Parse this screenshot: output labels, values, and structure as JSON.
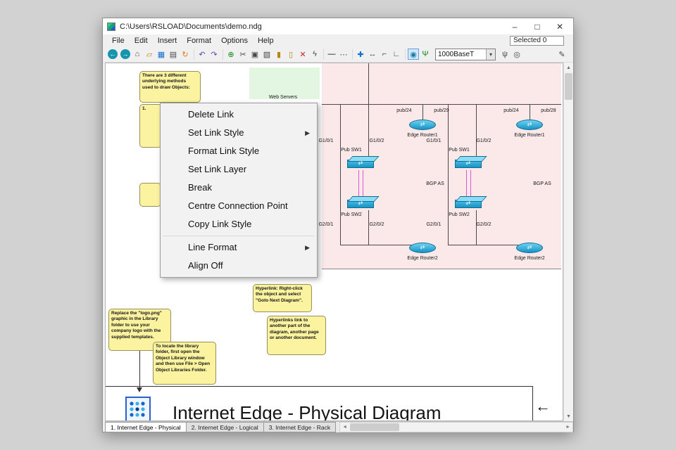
{
  "window": {
    "title": "C:\\Users\\RSLOAD\\Documents\\demo.ndg",
    "minimize": "–",
    "maximize": "□",
    "close": "✕"
  },
  "menubar": {
    "items": [
      "File",
      "Edit",
      "Insert",
      "Format",
      "Options",
      "Help"
    ],
    "selected_status": "Selected 0"
  },
  "toolbar": {
    "icons": [
      {
        "name": "back",
        "glyph": "←"
      },
      {
        "name": "forward",
        "glyph": "→"
      },
      {
        "name": "home",
        "glyph": "⌂"
      },
      {
        "name": "open-folder",
        "glyph": "▱"
      },
      {
        "name": "save",
        "glyph": "▦"
      },
      {
        "name": "print",
        "glyph": "▤"
      },
      {
        "name": "refresh",
        "glyph": "↻"
      },
      {
        "name": "undo",
        "glyph": "↶"
      },
      {
        "name": "redo",
        "glyph": "↷"
      },
      {
        "name": "globe",
        "glyph": "⊕"
      },
      {
        "name": "cut",
        "glyph": "✂"
      },
      {
        "name": "copy",
        "glyph": "▣"
      },
      {
        "name": "paste",
        "glyph": "▧"
      },
      {
        "name": "lock",
        "glyph": "▮"
      },
      {
        "name": "unlock",
        "glyph": "▯"
      },
      {
        "name": "delete",
        "glyph": "✕"
      },
      {
        "name": "polyline",
        "glyph": "ϟ"
      },
      {
        "name": "line-style",
        "glyph": "—"
      },
      {
        "name": "dash-style",
        "glyph": "⋯"
      },
      {
        "name": "crosshair",
        "glyph": "✚"
      },
      {
        "name": "move",
        "glyph": "↔"
      },
      {
        "name": "step-up",
        "glyph": "⌐"
      },
      {
        "name": "step-down",
        "glyph": "∟"
      },
      {
        "name": "snap",
        "glyph": "◉"
      },
      {
        "name": "antenna",
        "glyph": "Ψ"
      },
      {
        "name": "wireless",
        "glyph": "ψ"
      },
      {
        "name": "zoom",
        "glyph": "◎"
      },
      {
        "name": "notes",
        "glyph": "✎"
      }
    ],
    "link_type": "1000BaseT",
    "dropdown_caret": "▾"
  },
  "context_menu": {
    "items": [
      "Delete Link",
      "Set Link Style",
      "Format Link Style",
      "Set Link Layer",
      "Break",
      "Centre Connection Point",
      "Copy Link Style",
      "Line Format",
      "Align Off"
    ],
    "submenu_arrow": "▶"
  },
  "notes": {
    "methods": "There are 3 different underlying methods used to draw Objects:",
    "methods_fragment": "1.",
    "logo": "Replace the \"logo.png\" graphic in the Library folder to use your company logo with the supplied templates.",
    "library": "To locate the library folder, first open the Object Library window and then use File > Open Object Libraries Folder.",
    "hyperlink": "Hyperlink: Right-click the object and select \"Goto Next Diagram\".",
    "hyperlink2": "Hyperlinks link to another part of the diagram, another page or another document."
  },
  "diagram": {
    "web_servers_label": "Web Servers",
    "title": "Internet Edge - Physical Diagram",
    "arrow_glyph": "←",
    "left_group": {
      "net_left": "pub/24",
      "net_right": "pub/29",
      "router1": "Edge Router1",
      "router2": "Edge Router2",
      "sw1": "Pub SW1",
      "sw2": "Pub SW2",
      "if1": "G1/0/1",
      "if2": "G1/0/2",
      "if3": "G2/0/1",
      "if4": "G2/0/2",
      "bgp": "BGP AS"
    },
    "right_group": {
      "net_left": "pub/24",
      "net_right": "pub/28",
      "router1": "Edge Router1",
      "router2": "Edge Router2",
      "sw1": "Pub SW1",
      "sw2": "Pub SW2",
      "if1": "G1/0/1",
      "if2": "G1/0/2",
      "if3": "G2/0/1",
      "if4": "G2/0/2",
      "bgp": "BGP AS"
    }
  },
  "scrollbar": {
    "up": "▲",
    "down": "▼",
    "left": "◄",
    "right": "►"
  },
  "tabs": [
    "1. Internet Edge - Physical",
    "2. Internet Edge - Logical",
    "3. Internet Edge - Rack"
  ],
  "colors": {
    "device": "#2aa9d8",
    "link": "#d55ad5",
    "note": "#fbf3a0",
    "region_pink": "#fbe9e9",
    "region_green": "#e2f6e2"
  }
}
